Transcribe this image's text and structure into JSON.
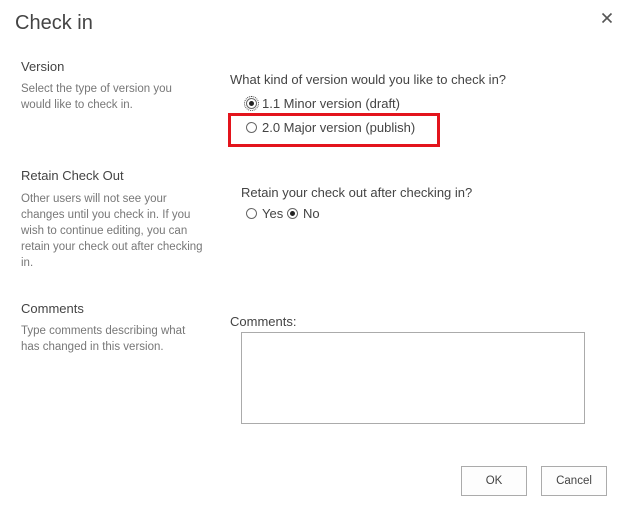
{
  "dialog": {
    "title": "Check in",
    "close_icon": "close-icon"
  },
  "version_section": {
    "title": "Version",
    "description": "Select the type of version you would like to check in.",
    "question": "What kind of version would you like to check in?",
    "options": [
      {
        "label": "1.1 Minor version (draft)",
        "selected": true
      },
      {
        "label": "2.0 Major version (publish)",
        "selected": false
      }
    ],
    "highlight_color": "#e3141c"
  },
  "retain_section": {
    "title": "Retain Check Out",
    "description": "Other users will not see your changes until you check in. If you wish to continue editing, you can retain your check out after checking in.",
    "question": "Retain your check out after checking in?",
    "options": [
      {
        "label": "Yes",
        "selected": false
      },
      {
        "label": "No",
        "selected": true
      }
    ]
  },
  "comments_section": {
    "title": "Comments",
    "description": "Type comments describing what has changed in this version.",
    "label": "Comments:",
    "value": ""
  },
  "buttons": {
    "ok_label": "OK",
    "cancel_label": "Cancel"
  }
}
